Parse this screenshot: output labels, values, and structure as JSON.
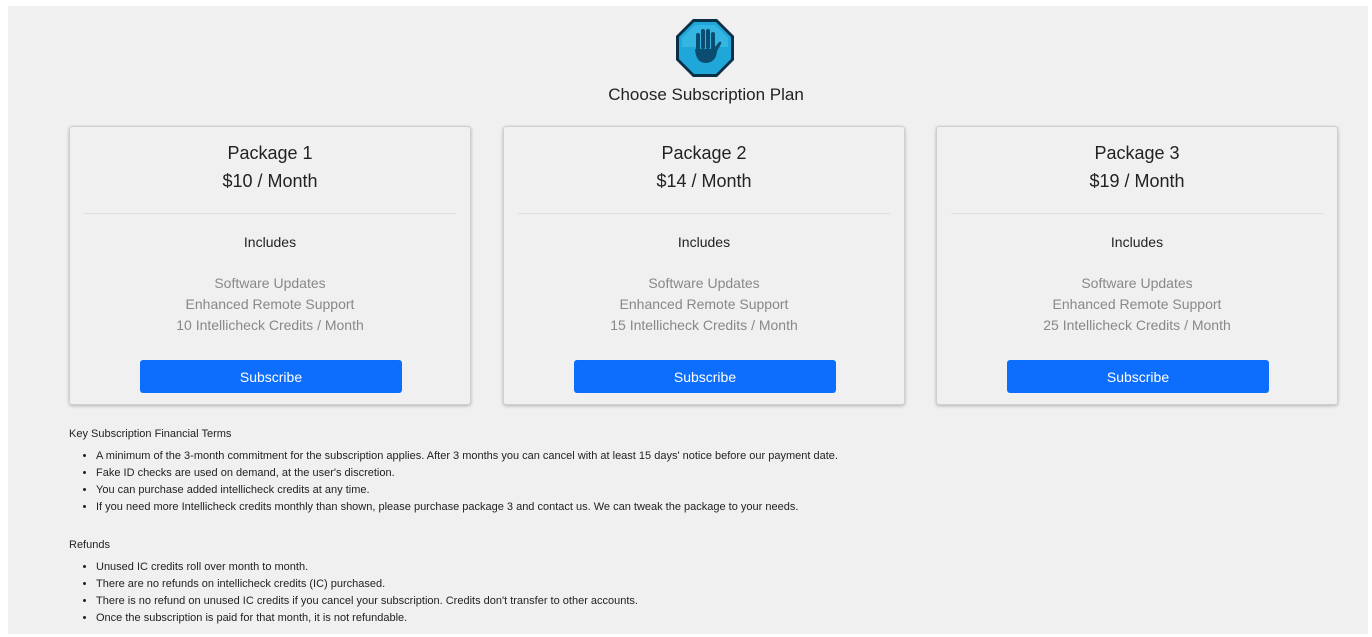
{
  "header": {
    "logo_icon": "hand-stop-icon",
    "title": "Choose Subscription Plan"
  },
  "packages": [
    {
      "name": "Package 1",
      "price": "$10 / Month",
      "includes_label": "Includes",
      "features": [
        "Software Updates",
        "Enhanced Remote Support",
        "10 Intellicheck Credits / Month"
      ],
      "button_label": "Subscribe"
    },
    {
      "name": "Package 2",
      "price": "$14 / Month",
      "includes_label": "Includes",
      "features": [
        "Software Updates",
        "Enhanced Remote Support",
        "15 Intellicheck Credits / Month"
      ],
      "button_label": "Subscribe"
    },
    {
      "name": "Package 3",
      "price": "$19 / Month",
      "includes_label": "Includes",
      "features": [
        "Software Updates",
        "Enhanced Remote Support",
        "25 Intellicheck Credits / Month"
      ],
      "button_label": "Subscribe"
    }
  ],
  "financial_terms": {
    "heading": "Key Subscription Financial Terms",
    "items": [
      "A minimum of the 3-month commitment for the subscription applies. After 3 months you can cancel with at least 15 days' notice before our payment date.",
      "Fake ID checks are used on demand, at the user's discretion.",
      "You can purchase added intellicheck credits at any time.",
      "If you need more Intellicheck credits monthly than shown, please purchase package 3 and contact us. We can tweak the package to your needs."
    ]
  },
  "refunds": {
    "heading": "Refunds",
    "items": [
      "Unused IC credits roll over month to month.",
      "There are no refunds on intellicheck credits (IC) purchased.",
      "There is no refund on unused IC credits if you cancel your subscription. Credits don't transfer to other accounts.",
      "Once the subscription is paid for that month, it is not refundable."
    ]
  },
  "colors": {
    "accent": "#0d6efd",
    "logo_blue": "#1ea7d8",
    "background": "#f0f0f0"
  }
}
